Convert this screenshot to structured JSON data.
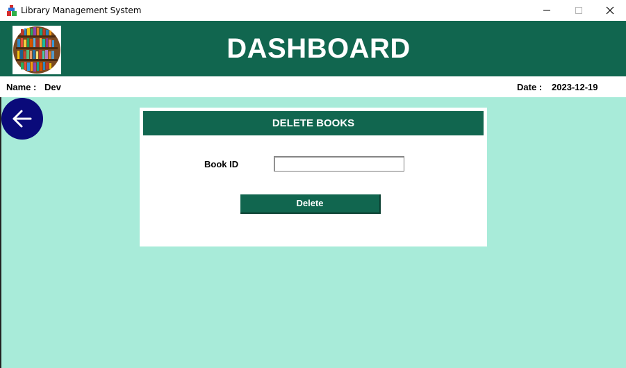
{
  "window": {
    "title": "Library Management System",
    "controls": [
      "minimize",
      "maximize",
      "close"
    ]
  },
  "header": {
    "title": "DASHBOARD",
    "logo_icon": "bookshelf-logo",
    "bg_color": "#11664f"
  },
  "info": {
    "name_label": "Name :",
    "name_value": "Dev",
    "date_label": "Date :",
    "date_value": "2023-12-19"
  },
  "back_button": {
    "icon": "arrow-left-icon",
    "color": "#0a0a7a"
  },
  "panel": {
    "title": "DELETE BOOKS",
    "book_id_label": "Book ID",
    "book_id_value": "",
    "delete_label": "Delete"
  },
  "colors": {
    "background": "#a8ebd9",
    "accent": "#11664f"
  }
}
